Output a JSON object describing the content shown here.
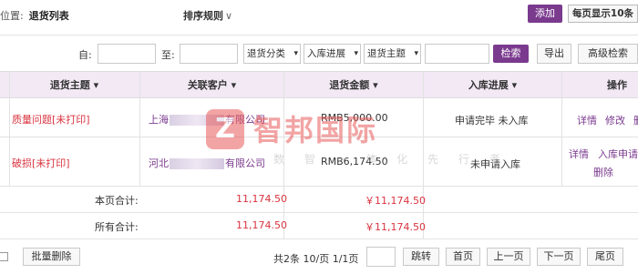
{
  "header": {
    "location_prefix": "位置:",
    "location_current": "退货列表",
    "sort_label": "排序规则",
    "sort_chevron": "∨",
    "add_label": "添加",
    "per_page_label": "每页显示10条"
  },
  "filters": {
    "from_label": "自:",
    "to_label": "至:",
    "return_category": "退货分类",
    "stock_progress": "入库进展",
    "return_subject": "退货主题",
    "search_label": "检索",
    "export_label": "导出",
    "advanced_label": "高级检索",
    "dropdown_glyph": "▾"
  },
  "table": {
    "headers": {
      "subject": "退货主题",
      "customer": "关联客户",
      "amount": "退货金额",
      "progress": "入库进展",
      "action": "操作"
    },
    "header_glyph": "▾",
    "rows": [
      {
        "subject": "质量问题",
        "subject_tag": "[未打印]",
        "customer_prefix": "上海",
        "customer_suffix": "有限公司",
        "amount": "RMB5,000.00",
        "progress": "申请完毕 未入库",
        "actions": [
          "详情",
          "修改",
          "删"
        ]
      },
      {
        "subject": "破损",
        "subject_tag": "[未打印]",
        "customer_prefix": "河北",
        "customer_suffix": "有限公司",
        "amount": "RMB6,174.50",
        "progress": "未申请入库",
        "actions": [
          "详情",
          "入库申请",
          "删除"
        ]
      }
    ],
    "page_total_label": "本页合计:",
    "page_total_value": "11,174.50",
    "page_total_amount": "￥11,174.50",
    "all_total_label": "所有合计:",
    "all_total_value": "11,174.50",
    "all_total_amount": "￥11,174.50"
  },
  "watermark": {
    "logo_letter": "Z",
    "title": "智邦国际",
    "subtitle": "数 智 一 体 化 先 行 者"
  },
  "footer": {
    "bulk_delete": "批量删除",
    "page_info": "共2条  10/页  1/1页",
    "jump": "跳转",
    "first": "首页",
    "prev": "上一页",
    "next": "下一页",
    "last": "尾页"
  },
  "colors": {
    "accent": "#7a3a8e",
    "header_bg": "#f2e9f5",
    "red": "#d9333f",
    "watermark": "#e85a5a"
  }
}
